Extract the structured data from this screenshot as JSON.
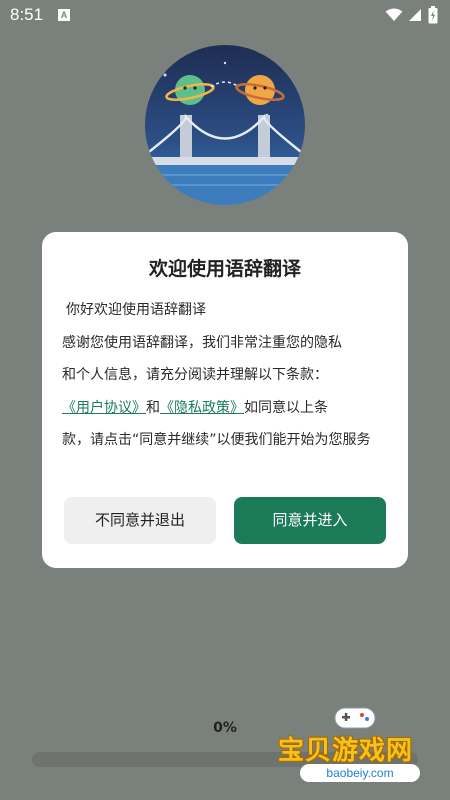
{
  "status_bar": {
    "time": "8:51",
    "badge": "A"
  },
  "dialog": {
    "title": "欢迎使用语辞翻译",
    "greeting": "你好欢迎使用语辞翻译",
    "line1": "感谢您使用语辞翻译，我们非常注重您的隐私",
    "line2": "和个人信息，请充分阅读并理解以下条款：",
    "link_user": "《用户协议》",
    "and": "和",
    "link_privacy": "《隐私政策》",
    "line3_tail": "如同意以上条",
    "line4": "款，请点击“同意并继续”以便我们能开始为您服务",
    "btn_disagree": "不同意并退出",
    "btn_agree": "同意并进入"
  },
  "progress": {
    "label": "0%",
    "value": 0
  },
  "watermark": {
    "text": "宝贝游戏网",
    "url": "baobeiy.com"
  },
  "colors": {
    "accent": "#1b7a58",
    "link": "#1b7c5b",
    "overlay": "#7a807b"
  }
}
